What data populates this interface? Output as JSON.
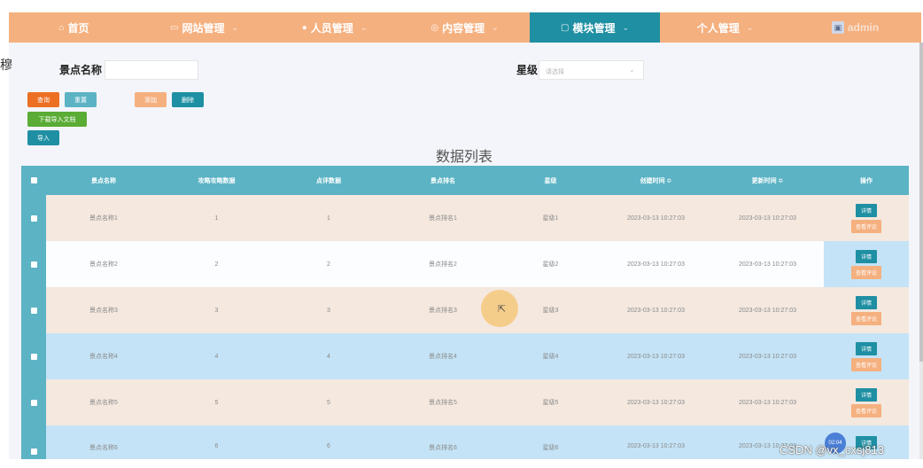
{
  "nav": {
    "items": [
      {
        "label": "首页",
        "icon": "home-icon",
        "active": false
      },
      {
        "label": "网站管理",
        "icon": "monitor-icon",
        "active": false
      },
      {
        "label": "人员管理",
        "icon": "user-icon",
        "active": false
      },
      {
        "label": "内容管理",
        "icon": "circle-icon",
        "active": false
      },
      {
        "label": "模块管理",
        "icon": "square-icon",
        "active": true
      },
      {
        "label": "个人管理",
        "icon": "",
        "active": false
      }
    ],
    "user": "admin"
  },
  "side_char": "穆",
  "search": {
    "name_label": "景点名称",
    "name_value": "",
    "star_label": "星级",
    "star_placeholder": "请选择"
  },
  "buttons": {
    "query": "查询",
    "reset": "重置",
    "add": "添加",
    "delete": "删除",
    "download": "下载导入文档",
    "import": "导入"
  },
  "table": {
    "title": "数据列表",
    "headers": [
      "景点名称",
      "攻略攻略数据",
      "点评数据",
      "景点排名",
      "星级",
      "创建时间 ≎",
      "更新时间 ≎",
      "操作"
    ],
    "rows": [
      [
        "景点名称1",
        "1",
        "1",
        "景点排名1",
        "星级1",
        "2023-03-13 10:27:03",
        "2023-03-13 10:27:03"
      ],
      [
        "景点名称2",
        "2",
        "2",
        "景点排名2",
        "星级2",
        "2023-03-13 10:27:03",
        "2023-03-13 10:27:03"
      ],
      [
        "景点名称3",
        "3",
        "3",
        "景点排名3",
        "星级3",
        "2023-03-13 10:27:03",
        "2023-03-13 10:27:03"
      ],
      [
        "景点名称4",
        "4",
        "4",
        "景点排名4",
        "星级4",
        "2023-03-13 10:27:03",
        "2023-03-13 10:27:03"
      ],
      [
        "景点名称5",
        "5",
        "5",
        "景点排名5",
        "星级5",
        "2023-03-13 10:27:03",
        "2023-03-13 10:27:03"
      ],
      [
        "景点名称6",
        "6",
        "6",
        "景点排名6",
        "星级6",
        "2023-03-13 10:27:03",
        "2023-03-13 10:27:03"
      ]
    ],
    "op_detail": "详情",
    "op_review": "查看评论"
  },
  "overlay": {
    "bubble": "02:04",
    "watermark": "CSDN @vx_cxsj813"
  },
  "colors": {
    "accent": "#1f8fa3",
    "nav_bg": "#f5b07f",
    "header_bg": "#5bb3c4",
    "row_beige": "#f4e8df",
    "row_blue": "#c4e3f6",
    "row_white": "#fbfdff"
  }
}
